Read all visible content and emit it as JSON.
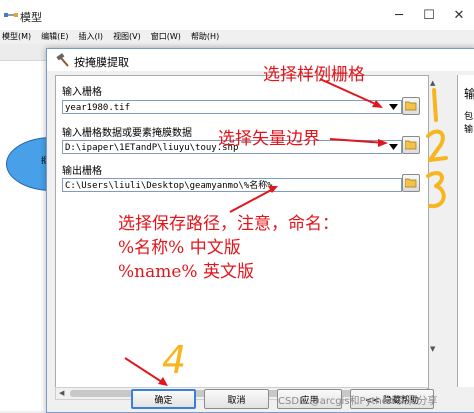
{
  "background_window": {
    "title": "模型",
    "menu": [
      "模型(M)",
      "编辑(E)",
      "插入(I)",
      "视图(V)",
      "窗口(W)",
      "帮助(H)"
    ],
    "node_label": "抠"
  },
  "dialog": {
    "title": "按掩膜提取",
    "fields": [
      {
        "label": "输入栅格",
        "value": "year1980.tif",
        "type": "combo"
      },
      {
        "label": "输入栅格数据或要素掩膜数据",
        "value": "D:\\ipaper\\1ETandP\\liuyu\\touy.shp",
        "type": "combo"
      },
      {
        "label": "输出栅格",
        "value": "C:\\Users\\liuli\\Desktop\\geamyanmo\\%名称%",
        "type": "text"
      }
    ],
    "help_title": "输",
    "help_text": [
      "包",
      "输"
    ],
    "buttons": {
      "ok": "确定",
      "cancel": "取消",
      "apply": "应用",
      "help": "<< 隐藏帮助"
    }
  },
  "annotations": {
    "step1": "选择样例栅格",
    "step2": "选择矢量边界",
    "step3_lines": [
      "选择保存路径，注意，命名：",
      "%名称% 中文版",
      "%name% 英文版"
    ],
    "marker4": "4"
  },
  "watermark": "CSDN @arcgis和Python 实验分享",
  "colors": {
    "annotation_red": "#e3141b",
    "marker_yellow": "#f7b51f",
    "accent_blue": "#3c7fd6"
  }
}
